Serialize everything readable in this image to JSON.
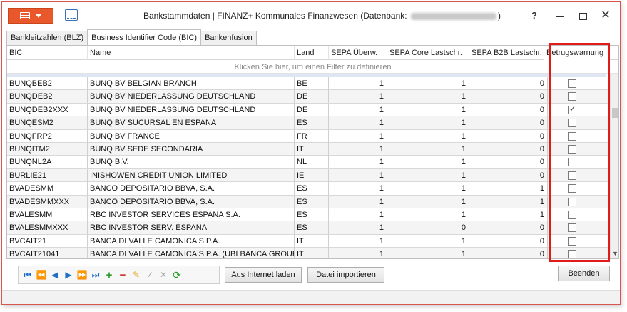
{
  "window": {
    "title_prefix": "Bankstammdaten | FINANZ+ Kommunales Finanzwesen (Datenbank:",
    "title_suffix": ")",
    "help_label": "?",
    "close_label": "✕"
  },
  "tabs": [
    {
      "label": "Bankleitzahlen (BLZ)"
    },
    {
      "label": "Business Identifier Code (BIC)"
    },
    {
      "label": "Bankenfusion"
    }
  ],
  "columns": {
    "bic": "BIC",
    "name": "Name",
    "land": "Land",
    "sepa_ueberw": "SEPA Überw.",
    "sepa_core": "SEPA Core Lastschr.",
    "sepa_b2b": "SEPA B2B Lastschr.",
    "betrug": "Betrugswarnung"
  },
  "filter_hint": "Klicken Sie hier,  um einen Filter zu definieren",
  "rows": [
    {
      "bic": "BUNQBEB2",
      "name": "BUNQ BV BELGIAN BRANCH",
      "land": "BE",
      "ueberw": "1",
      "core": "1",
      "b2b": "0",
      "warn": false
    },
    {
      "bic": "BUNQDEB2",
      "name": "BUNQ BV NIEDERLASSUNG DEUTSCHLAND",
      "land": "DE",
      "ueberw": "1",
      "core": "1",
      "b2b": "0",
      "warn": false
    },
    {
      "bic": "BUNQDEB2XXX",
      "name": "BUNQ BV NIEDERLASSUNG DEUTSCHLAND",
      "land": "DE",
      "ueberw": "1",
      "core": "1",
      "b2b": "0",
      "warn": true
    },
    {
      "bic": "BUNQESM2",
      "name": "BUNQ BV SUCURSAL EN ESPANA",
      "land": "ES",
      "ueberw": "1",
      "core": "1",
      "b2b": "0",
      "warn": false
    },
    {
      "bic": "BUNQFRP2",
      "name": "BUNQ BV FRANCE",
      "land": "FR",
      "ueberw": "1",
      "core": "1",
      "b2b": "0",
      "warn": false
    },
    {
      "bic": "BUNQITM2",
      "name": "BUNQ BV SEDE SECONDARIA",
      "land": "IT",
      "ueberw": "1",
      "core": "1",
      "b2b": "0",
      "warn": false
    },
    {
      "bic": "BUNQNL2A",
      "name": "BUNQ B.V.",
      "land": "NL",
      "ueberw": "1",
      "core": "1",
      "b2b": "0",
      "warn": false
    },
    {
      "bic": "BURLIE21",
      "name": "INISHOWEN CREDIT UNION LIMITED",
      "land": "IE",
      "ueberw": "1",
      "core": "1",
      "b2b": "0",
      "warn": false
    },
    {
      "bic": "BVADESMM",
      "name": "BANCO DEPOSITARIO BBVA, S.A.",
      "land": "ES",
      "ueberw": "1",
      "core": "1",
      "b2b": "1",
      "warn": false
    },
    {
      "bic": "BVADESMMXXX",
      "name": "BANCO DEPOSITARIO BBVA, S.A.",
      "land": "ES",
      "ueberw": "1",
      "core": "1",
      "b2b": "1",
      "warn": false
    },
    {
      "bic": "BVALESMM",
      "name": "RBC INVESTOR SERVICES ESPANA S.A.",
      "land": "ES",
      "ueberw": "1",
      "core": "1",
      "b2b": "1",
      "warn": false
    },
    {
      "bic": "BVALESMMXXX",
      "name": "RBC INVESTOR SERV. ESPANA",
      "land": "ES",
      "ueberw": "1",
      "core": "0",
      "b2b": "0",
      "warn": false
    },
    {
      "bic": "BVCAIT21",
      "name": "BANCA DI VALLE CAMONICA S.P.A.",
      "land": "IT",
      "ueberw": "1",
      "core": "1",
      "b2b": "0",
      "warn": false
    },
    {
      "bic": "BVCAIT21041",
      "name": "BANCA DI VALLE CAMONICA S.P.A. (UBI BANCA GROUP)",
      "land": "IT",
      "ueberw": "1",
      "core": "1",
      "b2b": "0",
      "warn": false
    }
  ],
  "buttons": {
    "load_internet": "Aus Internet laden",
    "import_file": "Datei importieren",
    "close": "Beenden"
  }
}
